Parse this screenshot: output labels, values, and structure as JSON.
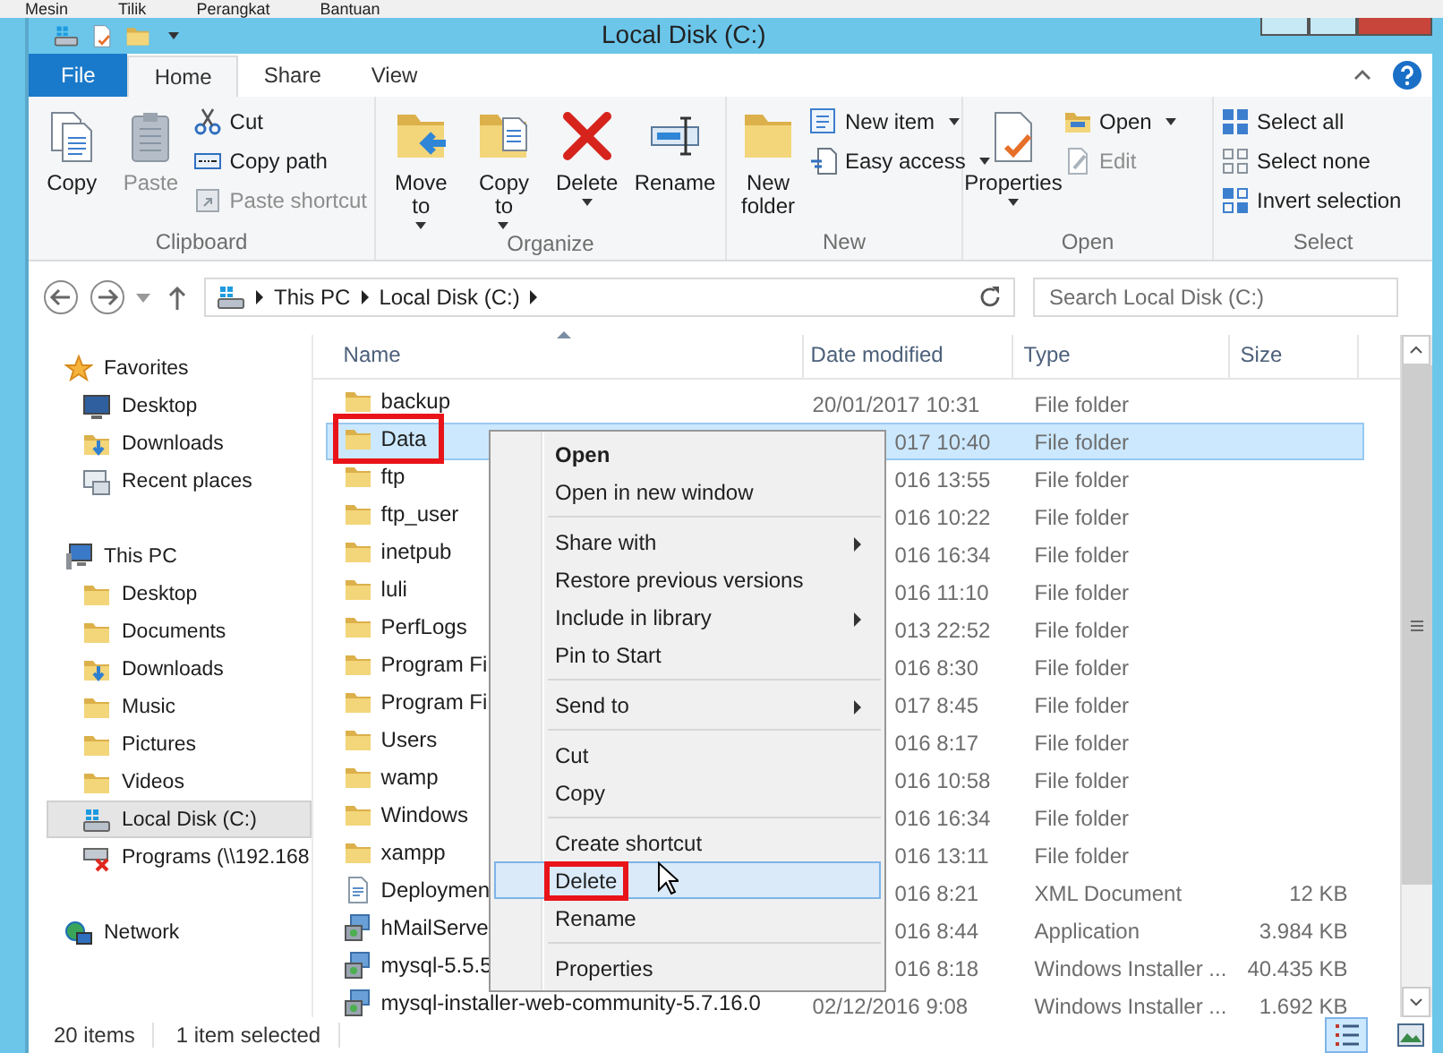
{
  "vm_menu": [
    "Mesin",
    "Tilik",
    "Perangkat",
    "Bantuan"
  ],
  "window": {
    "title": "Local Disk (C:)"
  },
  "ribbon_tabs": [
    {
      "label": "File",
      "kind": "file",
      "selected": false
    },
    {
      "label": "Home",
      "kind": "tab",
      "selected": true
    },
    {
      "label": "Share",
      "kind": "tab",
      "selected": false
    },
    {
      "label": "View",
      "kind": "tab",
      "selected": false
    }
  ],
  "ribbon_groups": [
    {
      "label": "Clipboard",
      "large": [
        {
          "label": "Copy",
          "disabled": false,
          "dropdown": false
        },
        {
          "label": "Paste",
          "disabled": true,
          "dropdown": false
        }
      ],
      "small": [
        {
          "label": "Cut",
          "disabled": false,
          "dropdown": false
        },
        {
          "label": "Copy path",
          "disabled": false,
          "dropdown": false
        },
        {
          "label": "Paste shortcut",
          "disabled": true,
          "dropdown": false
        }
      ]
    },
    {
      "label": "Organize",
      "large": [
        {
          "label": "Move to",
          "disabled": false,
          "dropdown": true
        },
        {
          "label": "Copy to",
          "disabled": false,
          "dropdown": true
        },
        {
          "label": "Delete",
          "disabled": false,
          "dropdown": true
        },
        {
          "label": "Rename",
          "disabled": false,
          "dropdown": false
        }
      ]
    },
    {
      "label": "New",
      "large": [
        {
          "label": "New folder",
          "disabled": false,
          "dropdown": false
        }
      ],
      "small": [
        {
          "label": "New item",
          "disabled": false,
          "dropdown": true
        },
        {
          "label": "Easy access",
          "disabled": false,
          "dropdown": true
        }
      ]
    },
    {
      "label": "Open",
      "large": [
        {
          "label": "Properties",
          "disabled": false,
          "dropdown": true
        }
      ],
      "small": [
        {
          "label": "Open",
          "disabled": false,
          "dropdown": true
        },
        {
          "label": "Edit",
          "disabled": true,
          "dropdown": false
        }
      ]
    },
    {
      "label": "Select",
      "small": [
        {
          "label": "Select all",
          "disabled": false,
          "dropdown": false
        },
        {
          "label": "Select none",
          "disabled": false,
          "dropdown": false
        },
        {
          "label": "Invert selection",
          "disabled": false,
          "dropdown": false
        }
      ]
    }
  ],
  "address_bar": {
    "path": [
      "This PC",
      "Local Disk (C:)"
    ]
  },
  "search": {
    "placeholder": "Search Local Disk (C:)"
  },
  "nav_pane": [
    {
      "label": "Favorites",
      "kind": "star",
      "selected": false,
      "children": [
        {
          "label": "Desktop",
          "kind": "monitor",
          "selected": false
        },
        {
          "label": "Downloads",
          "kind": "download",
          "selected": false
        },
        {
          "label": "Recent places",
          "kind": "recent",
          "selected": false
        }
      ]
    },
    {
      "label": "This PC",
      "kind": "computer",
      "selected": false,
      "children": [
        {
          "label": "Desktop",
          "kind": "folder",
          "selected": false
        },
        {
          "label": "Documents",
          "kind": "folder",
          "selected": false
        },
        {
          "label": "Downloads",
          "kind": "download",
          "selected": false
        },
        {
          "label": "Music",
          "kind": "folder",
          "selected": false
        },
        {
          "label": "Pictures",
          "kind": "folder",
          "selected": false
        },
        {
          "label": "Videos",
          "kind": "folder",
          "selected": false
        },
        {
          "label": "Local Disk (C:)",
          "kind": "drive",
          "selected": true
        },
        {
          "label": "Programs (\\\\192.168",
          "kind": "network-drive",
          "selected": false
        }
      ]
    },
    {
      "label": "Network",
      "kind": "network",
      "selected": false
    }
  ],
  "table": {
    "columns": [
      "Name",
      "Date modified",
      "Type",
      "Size"
    ],
    "rows": [
      {
        "name": "backup",
        "date": "20/01/2017 10:31",
        "type": "File folder",
        "kind": "folder",
        "selected": false,
        "under_menu": false,
        "annotated": false
      },
      {
        "name": "Data",
        "date": "017 10:40",
        "type": "File folder",
        "kind": "folder",
        "selected": true,
        "under_menu": true,
        "annotated": true
      },
      {
        "name": "ftp",
        "date": "016 13:55",
        "type": "File folder",
        "kind": "folder",
        "selected": false,
        "under_menu": true,
        "annotated": false
      },
      {
        "name": "ftp_user",
        "date": "016 10:22",
        "type": "File folder",
        "kind": "folder",
        "selected": false,
        "under_menu": true,
        "annotated": false
      },
      {
        "name": "inetpub",
        "date": "016 16:34",
        "type": "File folder",
        "kind": "folder",
        "selected": false,
        "under_menu": true,
        "annotated": false
      },
      {
        "name": "luli",
        "date": "016 11:10",
        "type": "File folder",
        "kind": "folder",
        "selected": false,
        "under_menu": true,
        "annotated": false
      },
      {
        "name": "PerfLogs",
        "date": "013 22:52",
        "type": "File folder",
        "kind": "folder",
        "selected": false,
        "under_menu": true,
        "annotated": false
      },
      {
        "name": "Program Fi",
        "date": "016 8:30",
        "type": "File folder",
        "kind": "folder",
        "selected": false,
        "under_menu": true,
        "annotated": false
      },
      {
        "name": "Program Fi",
        "date": "017 8:45",
        "type": "File folder",
        "kind": "folder",
        "selected": false,
        "under_menu": true,
        "annotated": false
      },
      {
        "name": "Users",
        "date": "016 8:17",
        "type": "File folder",
        "kind": "folder",
        "selected": false,
        "under_menu": true,
        "annotated": false
      },
      {
        "name": "wamp",
        "date": "016 10:58",
        "type": "File folder",
        "kind": "folder",
        "selected": false,
        "under_menu": true,
        "annotated": false
      },
      {
        "name": "Windows",
        "date": "016 16:34",
        "type": "File folder",
        "kind": "folder",
        "selected": false,
        "under_menu": true,
        "annotated": false
      },
      {
        "name": "xampp",
        "date": "016 13:11",
        "type": "File folder",
        "kind": "folder",
        "selected": false,
        "under_menu": true,
        "annotated": false
      },
      {
        "name": "Deploymen",
        "date": "016 8:21",
        "type": "XML Document",
        "size": "12 KB",
        "kind": "document",
        "selected": false,
        "under_menu": true,
        "annotated": false
      },
      {
        "name": "hMailServe",
        "date": "016 8:44",
        "type": "Application",
        "size": "3.984 KB",
        "kind": "installer",
        "selected": false,
        "under_menu": true,
        "annotated": false
      },
      {
        "name": "mysql-5.5.5",
        "date": "016 8:18",
        "type": "Windows Installer ...",
        "size": "40.435 KB",
        "kind": "installer",
        "selected": false,
        "under_menu": true,
        "annotated": false
      },
      {
        "name": "mysql-installer-web-community-5.7.16.0",
        "date": "02/12/2016 9:08",
        "type": "Windows Installer ...",
        "size": "1.692 KB",
        "kind": "installer",
        "selected": false,
        "under_menu": false,
        "annotated": false
      }
    ]
  },
  "context_menu": [
    [
      {
        "label": "Open",
        "default": true,
        "submenu": false,
        "selected": false,
        "annotated": false
      },
      {
        "label": "Open in new window",
        "default": false,
        "submenu": false,
        "selected": false,
        "annotated": false
      }
    ],
    [
      {
        "label": "Share with",
        "default": false,
        "submenu": true,
        "selected": false,
        "annotated": false
      },
      {
        "label": "Restore previous versions",
        "default": false,
        "submenu": false,
        "selected": false,
        "annotated": false
      },
      {
        "label": "Include in library",
        "default": false,
        "submenu": true,
        "selected": false,
        "annotated": false
      },
      {
        "label": "Pin to Start",
        "default": false,
        "submenu": false,
        "selected": false,
        "annotated": false
      }
    ],
    [
      {
        "label": "Send to",
        "default": false,
        "submenu": true,
        "selected": false,
        "annotated": false
      }
    ],
    [
      {
        "label": "Cut",
        "default": false,
        "submenu": false,
        "selected": false,
        "annotated": false
      },
      {
        "label": "Copy",
        "default": false,
        "submenu": false,
        "selected": false,
        "annotated": false
      }
    ],
    [
      {
        "label": "Create shortcut",
        "default": false,
        "submenu": false,
        "selected": false,
        "annotated": false
      },
      {
        "label": "Delete",
        "default": false,
        "submenu": false,
        "selected": true,
        "annotated": true
      },
      {
        "label": "Rename",
        "default": false,
        "submenu": false,
        "selected": false,
        "annotated": false
      }
    ],
    [
      {
        "label": "Properties",
        "default": false,
        "submenu": false,
        "selected": false,
        "annotated": false
      }
    ]
  ],
  "status_bar": {
    "items": [
      "20 items",
      "1 item selected"
    ],
    "views": [
      {
        "kind": "details",
        "selected": true
      },
      {
        "kind": "large-icons",
        "selected": false
      }
    ]
  }
}
